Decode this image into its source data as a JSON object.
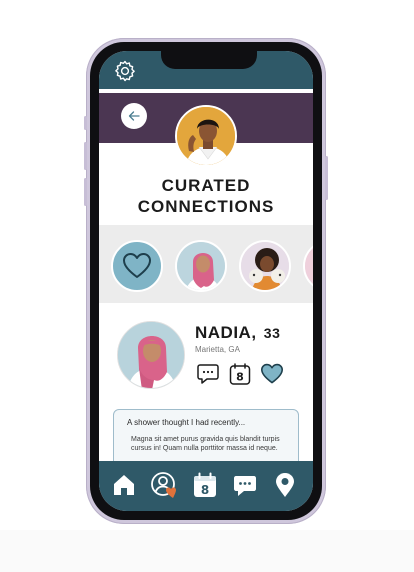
{
  "status_bar": {
    "settings_icon": "gear-icon"
  },
  "header": {
    "back_icon": "arrow-left-icon",
    "title_line1": "CURATED",
    "title_line2": "CONNECTIONS"
  },
  "matches": {
    "favorites_icon": "heart-icon",
    "items": [
      "avatar-1",
      "avatar-2",
      "avatar-3"
    ]
  },
  "profile": {
    "name": "NADIA,",
    "age": "33",
    "location": "Marietta, GA",
    "actions": [
      "chat-icon",
      "calendar-icon",
      "heart-icon"
    ],
    "calendar_day": "8"
  },
  "about": {
    "title": "A shower thought I had recently...",
    "body": "Magna sit amet purus gravida quis blandit turpis cursus in! Quam nulla porttitor massa id neque."
  },
  "tab_bar": {
    "items": [
      "home-icon",
      "profile-icon",
      "calendar-icon",
      "messages-icon",
      "location-icon"
    ],
    "calendar_day": "8"
  },
  "colors": {
    "teal": "#2f5968",
    "plum": "#4b3652",
    "light_blue": "#7fb4c6",
    "phone_frame": "#cfc7dc"
  }
}
